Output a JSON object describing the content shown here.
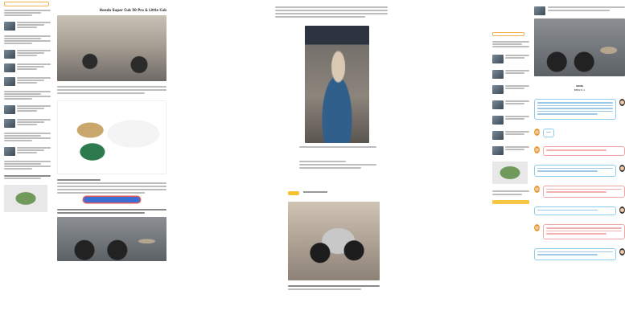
{
  "column1": {
    "sidebar_header_tag": "",
    "article_title": "Honda Super Cub 50 Pro & Little Cub",
    "button_label": ""
  },
  "column2": {
    "caption": "",
    "related_tag": ""
  },
  "column3": {
    "title_label": "VANS",
    "subtitle_label": "BMW R-1"
  },
  "colors": {
    "accent_yellow": "#f4c430",
    "cta_blue": "#3b6fd6",
    "bubble_blue": "#8ccdf2",
    "bubble_red": "#f2a5a5"
  },
  "icons": {
    "avatar_female": "avatar-icon",
    "avatar_male": "avatar-icon"
  }
}
